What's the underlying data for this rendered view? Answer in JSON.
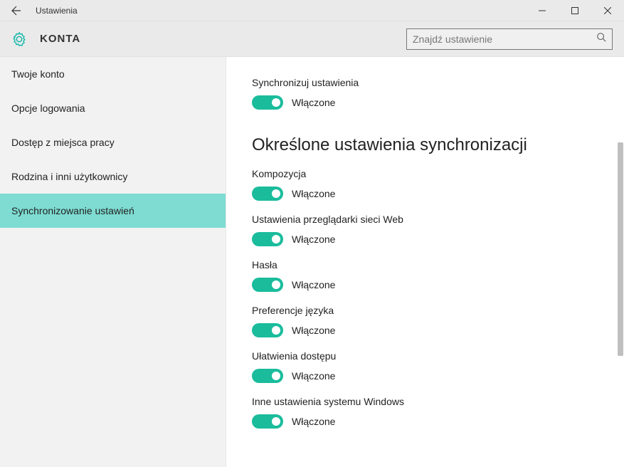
{
  "titlebar": {
    "title": "Ustawienia"
  },
  "header": {
    "title": "KONTA",
    "search_placeholder": "Znajdź ustawienie"
  },
  "sidebar": {
    "items": [
      {
        "label": "Twoje konto",
        "active": false
      },
      {
        "label": "Opcje logowania",
        "active": false
      },
      {
        "label": "Dostęp z miejsca pracy",
        "active": false
      },
      {
        "label": "Rodzina i inni użytkownicy",
        "active": false
      },
      {
        "label": "Synchronizowanie ustawień",
        "active": true
      }
    ]
  },
  "content": {
    "sync_main": {
      "label": "Synchronizuj ustawienia",
      "state": "Włączone"
    },
    "section_title": "Określone ustawienia synchronizacji",
    "settings": [
      {
        "label": "Kompozycja",
        "state": "Włączone"
      },
      {
        "label": "Ustawienia przeglądarki sieci Web",
        "state": "Włączone"
      },
      {
        "label": "Hasła",
        "state": "Włączone"
      },
      {
        "label": "Preferencje języka",
        "state": "Włączone"
      },
      {
        "label": "Ułatwienia dostępu",
        "state": "Włączone"
      },
      {
        "label": "Inne ustawienia systemu Windows",
        "state": "Włączone"
      }
    ]
  }
}
